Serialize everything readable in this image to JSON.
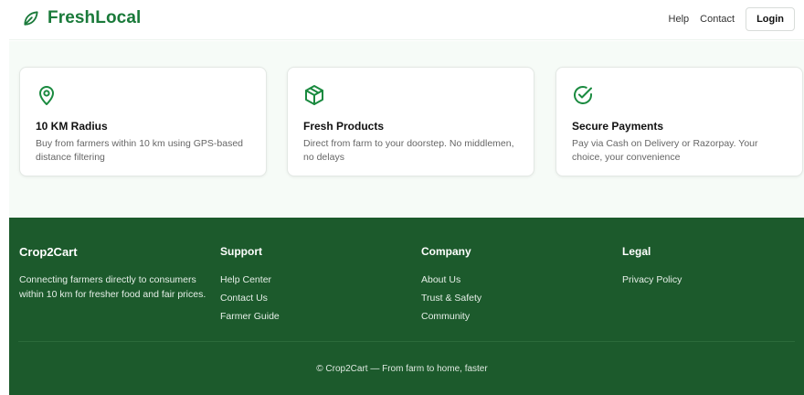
{
  "header": {
    "brand": "FreshLocal",
    "nav": [
      "Help",
      "Contact"
    ],
    "login": "Login",
    "brand_icon": "leaf-icon",
    "brand_color": "#1a7a3a"
  },
  "features": [
    {
      "icon": "map-pin-icon",
      "title": "10 KM Radius",
      "desc": "Buy from farmers within 10 km using GPS-based distance filtering"
    },
    {
      "icon": "package-icon",
      "title": "Fresh Products",
      "desc": "Direct from farm to your doorstep. No middlemen, no delays"
    },
    {
      "icon": "check-circle-icon",
      "title": "Secure Payments",
      "desc": "Pay via Cash on Delivery or Razorpay. Your choice, your convenience"
    }
  ],
  "footer": {
    "brand": "Crop2Cart",
    "tagline": "Connecting farmers directly to consumers within 10 km for fresher food and fair prices.",
    "support": {
      "title": "Support",
      "links": [
        "Help Center",
        "Contact Us",
        "Farmer Guide"
      ]
    },
    "company": {
      "title": "Company",
      "links": [
        "About Us",
        "Trust & Safety",
        "Community"
      ]
    },
    "legal": {
      "title": "Legal",
      "links": [
        "Privacy Policy"
      ]
    },
    "copyright": "© Crop2Cart — From farm to home, faster",
    "bg_color": "#1c5a2c"
  }
}
